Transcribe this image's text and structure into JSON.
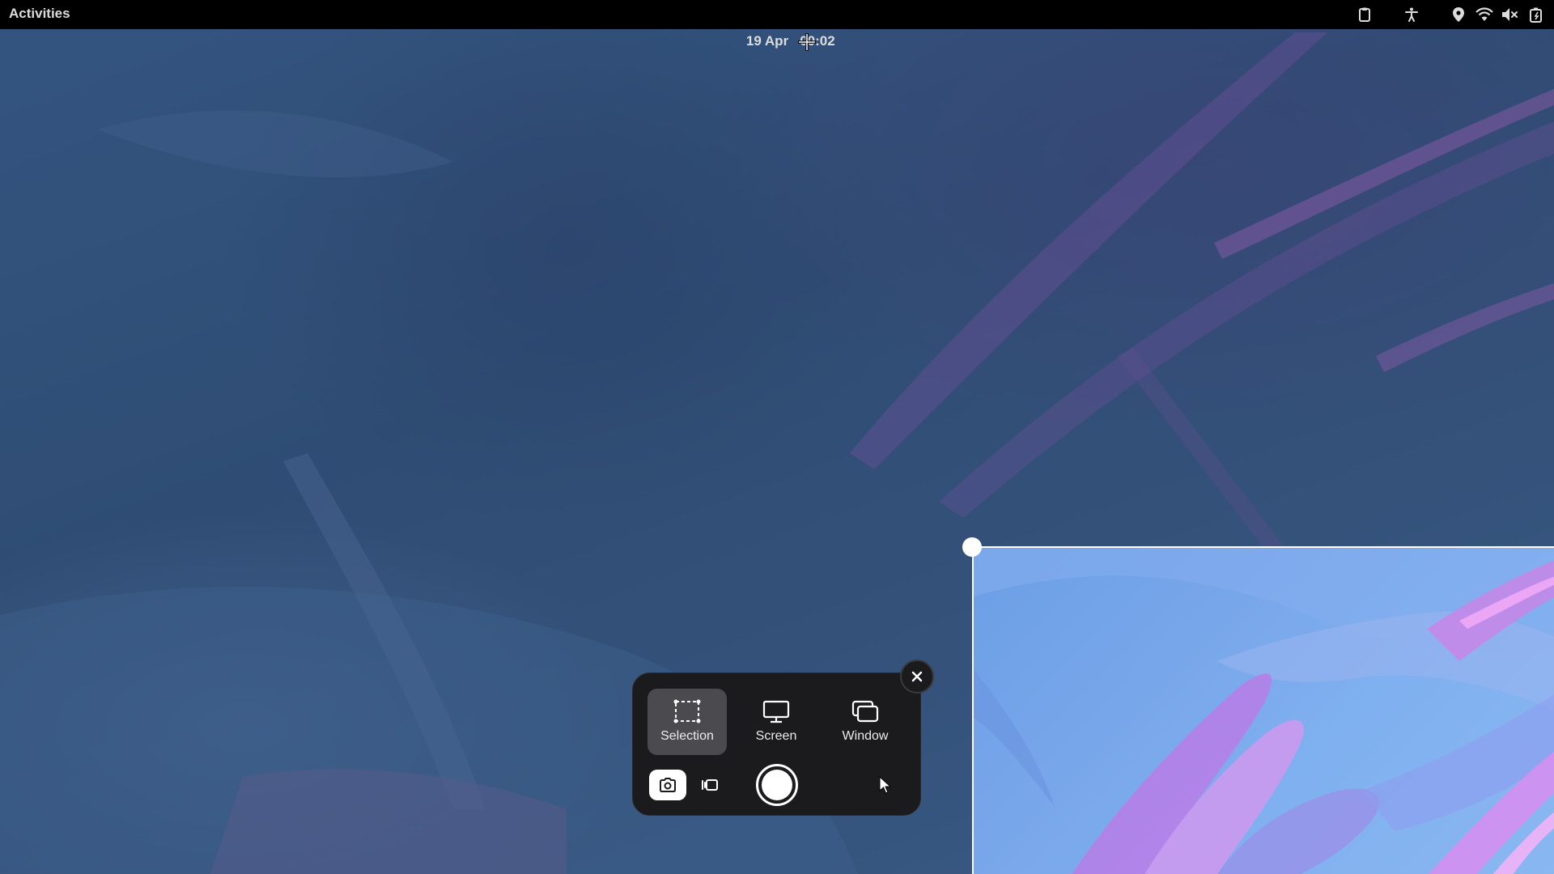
{
  "topbar": {
    "activities_label": "Activities",
    "date": "19 Apr",
    "time": "00:02",
    "tray_icons": [
      "clipboard-icon",
      "accessibility-icon",
      "location-icon",
      "wifi-icon",
      "volume-muted-icon",
      "battery-icon"
    ]
  },
  "screenshot_panel": {
    "modes": [
      {
        "label": "Selection",
        "icon": "selection-icon",
        "active": true
      },
      {
        "label": "Screen",
        "icon": "monitor-icon",
        "active": false
      },
      {
        "label": "Window",
        "icon": "window-icon",
        "active": false
      }
    ],
    "capture_type": {
      "options": [
        "screenshot",
        "screencast"
      ],
      "selected": "screenshot"
    },
    "show_pointer": false
  },
  "colors": {
    "topbar_bg": "#000000",
    "panel_bg": "#1b1b1d",
    "active_mode_bg": "#4b4b4f",
    "selection_border": "#ffffff"
  }
}
